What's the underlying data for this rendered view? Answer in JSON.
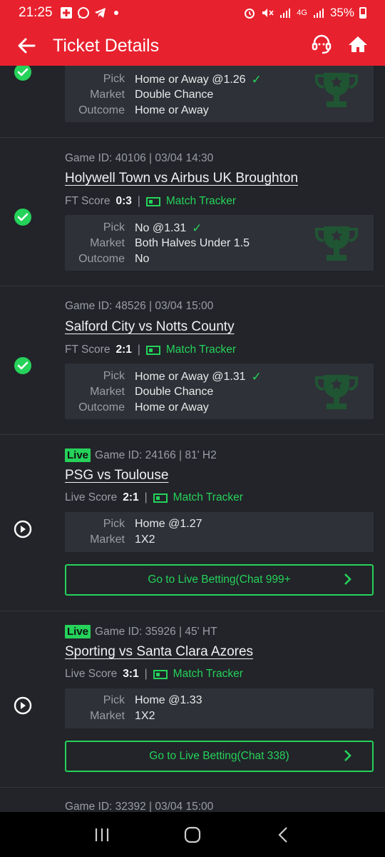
{
  "statusbar": {
    "time": "21:25",
    "network": "4G",
    "battery": "35%"
  },
  "header": {
    "title": "Ticket Details"
  },
  "colors": {
    "brand": "#e8212e",
    "won": "#25d25a",
    "background": "#222429",
    "card": "#2e3137"
  },
  "labels": {
    "pick": "Pick",
    "market": "Market",
    "outcome": "Outcome",
    "ft_score": "FT Score",
    "live_score": "Live Score",
    "match_tracker": "Match Tracker",
    "live": "Live",
    "separator": "|"
  },
  "tickets": [
    {
      "status": "won",
      "pick": "Home or Away @1.26",
      "market": "Double Chance",
      "outcome": "Home or Away"
    },
    {
      "status": "won",
      "meta": "Game ID: 40106 | 03/04 14:30",
      "match": "Holywell Town vs Airbus UK Broughton",
      "score": "0:3",
      "pick": "No @1.31",
      "market": "Both Halves Under 1.5",
      "outcome": "No"
    },
    {
      "status": "won",
      "meta": "Game ID: 48526 | 03/04 15:00",
      "match": "Salford City vs Notts County",
      "score": "2:1",
      "pick": "Home or Away @1.31",
      "market": "Double Chance",
      "outcome": "Home or Away"
    },
    {
      "status": "live",
      "meta": "Game ID: 24166 | 81' H2",
      "match": "PSG vs Toulouse",
      "score": "2:1",
      "pick": "Home @1.27",
      "market": "1X2",
      "button": "Go to Live Betting(Chat 999+"
    },
    {
      "status": "live",
      "meta": "Game ID: 35926 | 45' HT",
      "match": "Sporting vs Santa Clara Azores",
      "score": "3:1",
      "pick": "Home @1.33",
      "market": "1X2",
      "button": "Go to Live Betting(Chat 338)"
    },
    {
      "status": "pending",
      "meta": "Game ID: 32392 | 03/04 15:00"
    }
  ]
}
